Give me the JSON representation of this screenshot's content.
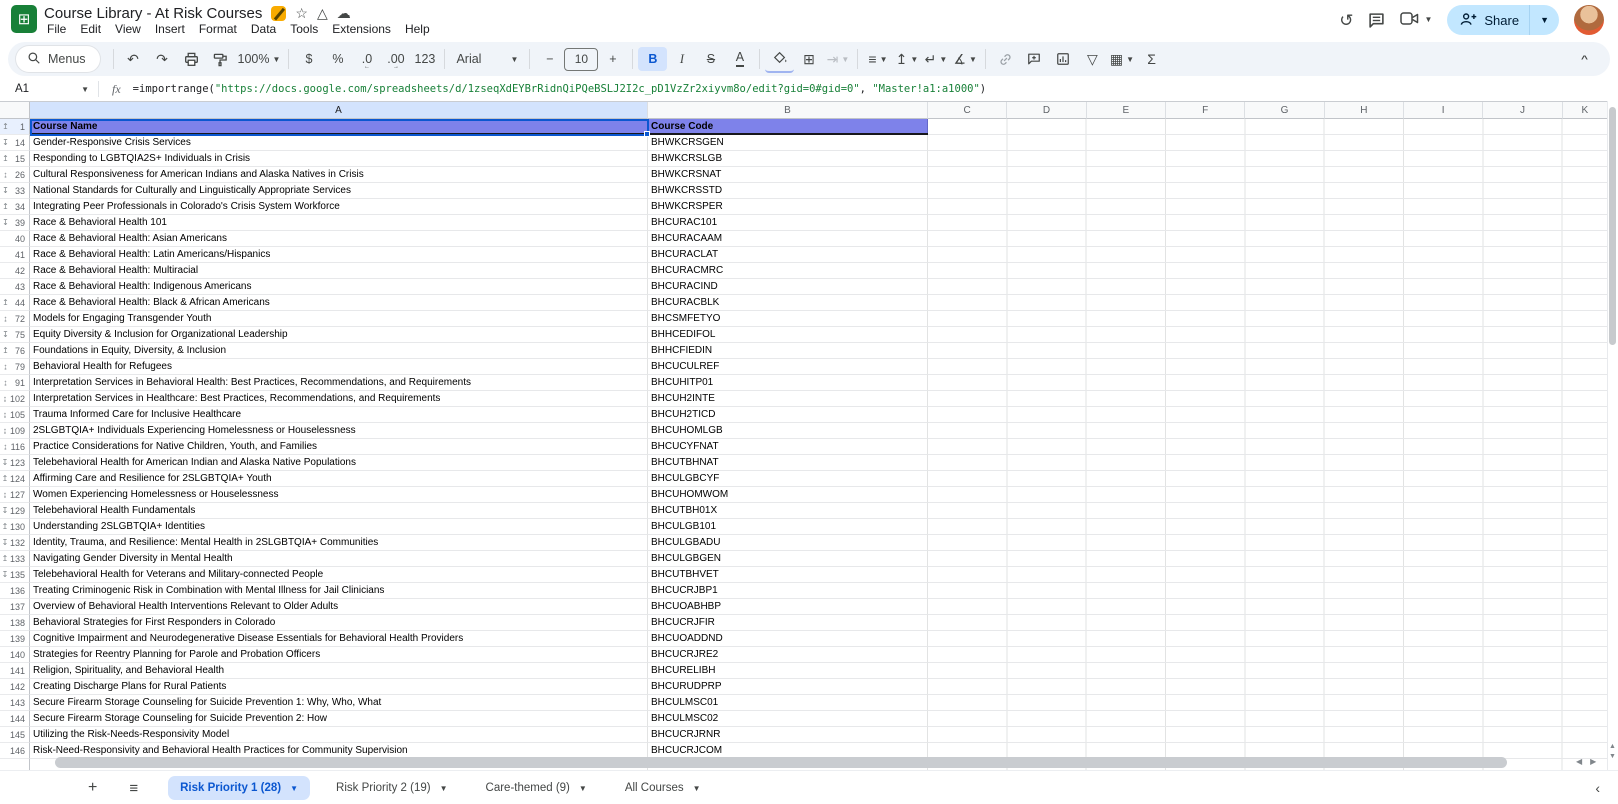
{
  "app": {
    "title": "Course Library - At Risk Courses",
    "menu": [
      "File",
      "Edit",
      "View",
      "Insert",
      "Format",
      "Data",
      "Tools",
      "Extensions",
      "Help"
    ],
    "share_label": "Share"
  },
  "toolbar": {
    "groups": [
      {
        "items": [
          {
            "name": "menus-chip",
            "icon": "search",
            "label": "Menus",
            "chip": true
          }
        ]
      },
      {
        "items": [
          {
            "name": "undo-button",
            "icon": "undo"
          },
          {
            "name": "redo-button",
            "icon": "redo"
          },
          {
            "name": "print-button",
            "icon": "printer"
          },
          {
            "name": "paint-format-button",
            "icon": "roller"
          },
          {
            "name": "zoom-select",
            "label": "100%",
            "caret": true
          }
        ]
      },
      {
        "items": [
          {
            "name": "format-currency-button",
            "label": "$"
          },
          {
            "name": "format-percent-button",
            "label": "%"
          },
          {
            "name": "decrease-decimals-button",
            "label": ".0",
            "sub": "←"
          },
          {
            "name": "increase-decimals-button",
            "label": ".00",
            "sub": "→"
          },
          {
            "name": "more-formats-button",
            "label": "123"
          }
        ]
      },
      {
        "items": [
          {
            "name": "font-family-select",
            "label": "Arial",
            "caret": true,
            "wide": true
          }
        ]
      },
      {
        "items": [
          {
            "name": "decrease-font-size-button",
            "label": "−"
          },
          {
            "name": "font-size-input",
            "label": "10",
            "boxed": true
          },
          {
            "name": "increase-font-size-button",
            "label": "+"
          }
        ]
      },
      {
        "items": [
          {
            "name": "bold-button",
            "label": "B",
            "active": true,
            "style": "b"
          },
          {
            "name": "italic-button",
            "label": "I",
            "style": "i"
          },
          {
            "name": "strikethrough-button",
            "label": "S",
            "style": "s"
          },
          {
            "name": "text-color-button",
            "label": "A",
            "ubar": true
          }
        ]
      },
      {
        "items": [
          {
            "name": "fill-color-button",
            "icon": "bucket",
            "ubar2": true
          },
          {
            "name": "borders-button",
            "icon": "borders"
          },
          {
            "name": "merge-cells-button",
            "icon": "merge",
            "caret": true,
            "disabled": true
          }
        ]
      },
      {
        "items": [
          {
            "name": "horizontal-align-button",
            "icon": "halign",
            "caret": true
          },
          {
            "name": "vertical-align-button",
            "icon": "valign",
            "caret": true
          },
          {
            "name": "text-wrap-button",
            "icon": "wrap",
            "caret": true
          },
          {
            "name": "text-rotation-button",
            "icon": "rotate",
            "caret": true
          }
        ]
      },
      {
        "items": [
          {
            "name": "insert-link-button",
            "icon": "link"
          },
          {
            "name": "insert-comment-button",
            "icon": "comment"
          },
          {
            "name": "insert-chart-button",
            "icon": "chart"
          },
          {
            "name": "filter-button",
            "icon": "filter"
          },
          {
            "name": "table-views-button",
            "icon": "views",
            "caret": true
          },
          {
            "name": "functions-button",
            "icon": "sum"
          }
        ]
      }
    ]
  },
  "formula_bar": {
    "cell_ref": "A1",
    "fx_label": "fx",
    "segments": [
      {
        "t": "=importrange(",
        "c": "plain"
      },
      {
        "t": "\"https://docs.google.com/spreadsheets/d/1zseqXdEYBrRidnQiPQeBSLJ2I2c_pD1VzZr2xiyvm8o/edit?gid=0#gid=0\"",
        "c": "string"
      },
      {
        "t": ", ",
        "c": "plain"
      },
      {
        "t": "\"Master!a1:a1000\"",
        "c": "string"
      },
      {
        "t": ")",
        "c": "plain"
      }
    ]
  },
  "grid": {
    "columns": [
      "A",
      "B",
      "C",
      "D",
      "E",
      "F",
      "G",
      "H",
      "I",
      "J",
      "K"
    ],
    "selected_column": "A",
    "header_row": {
      "n": "1",
      "h": "below",
      "name": "Course Name",
      "code": "Course Code"
    },
    "rows": [
      {
        "n": "14",
        "h": "above",
        "name": "Gender-Responsive Crisis Services",
        "code": "BHWKCRSGEN"
      },
      {
        "n": "15",
        "h": "below",
        "name": "Responding to LGBTQIA2S+ Individuals in Crisis",
        "code": "BHWKCRSLGB"
      },
      {
        "n": "26",
        "h": "both",
        "name": "Cultural Responsiveness for American Indians and Alaska Natives in Crisis",
        "code": "BHWKCRSNAT"
      },
      {
        "n": "33",
        "h": "above",
        "name": "National Standards for Culturally and Linguistically Appropriate Services",
        "code": "BHWKCRSSTD"
      },
      {
        "n": "34",
        "h": "below",
        "name": "Integrating Peer Professionals in Colorado's Crisis System Workforce",
        "code": "BHWKCRSPER"
      },
      {
        "n": "39",
        "h": "above",
        "name": "Race & Behavioral Health 101",
        "code": "BHCURAC101"
      },
      {
        "n": "40",
        "name": "Race & Behavioral Health: Asian Americans",
        "code": "BHCURACAAM"
      },
      {
        "n": "41",
        "name": "Race & Behavioral Health: Latin Americans/Hispanics",
        "code": "BHCURACLAT"
      },
      {
        "n": "42",
        "name": "Race & Behavioral Health: Multiracial",
        "code": "BHCURACMRC"
      },
      {
        "n": "43",
        "name": "Race & Behavioral Health: Indigenous Americans",
        "code": "BHCURACIND"
      },
      {
        "n": "44",
        "h": "below",
        "name": "Race & Behavioral Health: Black & African Americans",
        "code": "BHCURACBLK"
      },
      {
        "n": "72",
        "h": "both",
        "name": "Models for Engaging Transgender Youth",
        "code": "BHCSMFETYO"
      },
      {
        "n": "75",
        "h": "above",
        "name": "Equity Diversity & Inclusion for Organizational Leadership",
        "code": "BHHCEDIFOL"
      },
      {
        "n": "76",
        "h": "below",
        "name": "Foundations in Equity, Diversity, & Inclusion",
        "code": "BHHCFIEDIN"
      },
      {
        "n": "79",
        "h": "both",
        "name": "Behavioral Health for Refugees",
        "code": "BHCUCULREF"
      },
      {
        "n": "91",
        "h": "both",
        "name": "Interpretation Services in Behavioral Health: Best Practices, Recommendations, and Requirements",
        "code": "BHCUHITP01"
      },
      {
        "n": "102",
        "h": "both",
        "name": "Interpretation Services in Healthcare: Best Practices, Recommendations, and Requirements",
        "code": "BHCUH2INTE"
      },
      {
        "n": "105",
        "h": "both",
        "name": "Trauma Informed Care for Inclusive Healthcare",
        "code": "BHCUH2TICD"
      },
      {
        "n": "109",
        "h": "both",
        "name": "2SLGBTQIA+ Individuals Experiencing Homelessness or Houselessness",
        "code": "BHCUHOMLGB"
      },
      {
        "n": "116",
        "h": "both",
        "name": "Practice Considerations for Native Children, Youth, and Families",
        "code": "BHCUCYFNAT"
      },
      {
        "n": "123",
        "h": "above",
        "name": "Telebehavioral Health for American Indian and Alaska Native Populations",
        "code": "BHCUTBHNAT"
      },
      {
        "n": "124",
        "h": "below",
        "name": "Affirming Care and Resilience for 2SLGBTQIA+ Youth",
        "code": "BHCULGBCYF"
      },
      {
        "n": "127",
        "h": "both",
        "name": "Women Experiencing Homelessness or Houselessness",
        "code": "BHCUHOMWOM"
      },
      {
        "n": "129",
        "h": "above",
        "name": "Telebehavioral Health Fundamentals",
        "code": "BHCUTBH01X"
      },
      {
        "n": "130",
        "h": "below",
        "name": "Understanding 2SLGBTQIA+ Identities",
        "code": "BHCULGB101"
      },
      {
        "n": "132",
        "h": "above",
        "name": "Identity, Trauma, and Resilience: Mental Health in 2SLGBTQIA+ Communities",
        "code": "BHCULGBADU"
      },
      {
        "n": "133",
        "h": "below",
        "name": "Navigating Gender Diversity in Mental Health",
        "code": "BHCULGBGEN"
      },
      {
        "n": "135",
        "h": "above",
        "name": "Telebehavioral Health for Veterans and Military-connected People",
        "code": "BHCUTBHVET"
      },
      {
        "n": "136",
        "name": "Treating Criminogenic Risk in Combination with Mental Illness for Jail Clinicians",
        "code": "BHCUCRJBP1"
      },
      {
        "n": "137",
        "name": "Overview of Behavioral Health Interventions Relevant to Older Adults",
        "code": "BHCUOABHBP"
      },
      {
        "n": "138",
        "name": "Behavioral Strategies for First Responders in Colorado",
        "code": "BHCUCRJFIR"
      },
      {
        "n": "139",
        "name": "Cognitive Impairment and Neurodegenerative Disease Essentials for Behavioral Health Providers",
        "code": "BHCUOADDND"
      },
      {
        "n": "140",
        "name": "Strategies for Reentry Planning for Parole and Probation Officers",
        "code": "BHCUCRJRE2"
      },
      {
        "n": "141",
        "name": "Religion, Spirituality, and Behavioral Health",
        "code": "BHCURELIBH"
      },
      {
        "n": "142",
        "name": "Creating Discharge Plans for Rural Patients",
        "code": "BHCURUDPRP"
      },
      {
        "n": "143",
        "name": "Secure Firearm Storage Counseling for Suicide Prevention 1: Why, Who, What",
        "code": "BHCULMSC01"
      },
      {
        "n": "144",
        "name": "Secure Firearm Storage Counseling for Suicide Prevention 2: How",
        "code": "BHCULMSC02"
      },
      {
        "n": "145",
        "name": "Utilizing the Risk-Needs-Responsivity Model",
        "code": "BHCUCRJRNR"
      },
      {
        "n": "146",
        "name": "Risk-Need-Responsivity and Behavioral Health Practices for Community Supervision",
        "code": "BHCUCRJCOM"
      }
    ]
  },
  "sheetbar": {
    "add_label": "+",
    "all_sheets_label": "≡",
    "tabs": [
      {
        "label": "Risk Priority 1 (28)",
        "active": true
      },
      {
        "label": "Risk Priority 2 (19)",
        "active": false
      },
      {
        "label": "Care-themed (9)",
        "active": false
      },
      {
        "label": "All Courses",
        "active": false
      }
    ]
  },
  "colors": {
    "header_fill": "#7e82ea",
    "selected_header": "#d3e3fd",
    "active_tab_bg": "#d3e3fd",
    "active_tab_text": "#0b57d0",
    "share_bg": "#c2e7ff",
    "share_text": "#001d35",
    "formula_string": "#188038",
    "grid_line": "#e2e3e3",
    "row_line": "#e7e8ea",
    "toolbar_bg": "#f0f4f9",
    "logo_green": "#188038",
    "badge_amber": "#f9ab00",
    "selection_blue": "#0b57d0"
  }
}
